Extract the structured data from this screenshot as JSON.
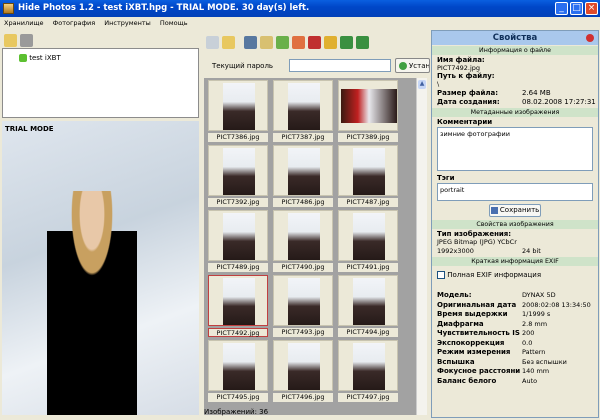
{
  "window": {
    "title": "Hide Photos 1.2 - test iXBT.hpg - TRIAL MODE. 30 day(s) left."
  },
  "menu": [
    "Хранилище",
    "Фотография",
    "Инструменты",
    "Помощь"
  ],
  "tree": {
    "item": "test iXBT"
  },
  "preview": {
    "overlay": "TRIAL MODE"
  },
  "password": {
    "label": "Текущий пароль",
    "value": "",
    "button": "Устан"
  },
  "thumbnails": [
    {
      "name": "PICT7386.jpg"
    },
    {
      "name": "PICT7387.jpg"
    },
    {
      "name": "PICT7389.jpg"
    },
    {
      "name": "PICT7392.jpg"
    },
    {
      "name": "PICT7486.jpg"
    },
    {
      "name": "PICT7487.jpg"
    },
    {
      "name": "PICT7489.jpg"
    },
    {
      "name": "PICT7490.jpg"
    },
    {
      "name": "PICT7491.jpg"
    },
    {
      "name": "PICT7492.jpg",
      "selected": true
    },
    {
      "name": "PICT7493.jpg"
    },
    {
      "name": "PICT7494.jpg"
    },
    {
      "name": "PICT7495.jpg"
    },
    {
      "name": "PICT7496.jpg"
    },
    {
      "name": "PICT7497.jpg"
    }
  ],
  "status": "Изображений: 36",
  "props": {
    "title": "Свойства",
    "file_section": "Информация о файле",
    "file_name_label": "Имя файла:",
    "file_name": "PICT7492.jpg",
    "path_label": "Путь к файлу:",
    "path": "\\",
    "size_label": "Размер файла:",
    "size": "2.64 MB",
    "date_label": "Дата создания:",
    "date": "08.02.2008 17:27:31",
    "meta_section": "Метаданные изображения",
    "comment_label": "Комментарии",
    "comment": "зимние фотографии",
    "tags_label": "Тэги",
    "tags": "portrait",
    "save": "Сохранить",
    "image_section": "Свойства изображения",
    "type_label": "Тип изображения:",
    "type": "JPEG Bitmap (JPG) YCbCr",
    "dims": "1992x3000",
    "bits": "24 bit",
    "exif_section": "Краткая информация EXIF",
    "full_exif": "Полная EXIF информация",
    "exif": [
      {
        "k": "Модель:",
        "v": "DYNAX 5D"
      },
      {
        "k": "Оригинальная дата",
        "v": "2008:02:08 13:34:50"
      },
      {
        "k": "Время выдержки",
        "v": "1/1999 s"
      },
      {
        "k": "Диафрагма",
        "v": "2.8 mm"
      },
      {
        "k": "Чувствительность IS",
        "v": "200"
      },
      {
        "k": "Экспокоррекция",
        "v": "0.0"
      },
      {
        "k": "Режим измерения",
        "v": "Pattern"
      },
      {
        "k": "Вспышка",
        "v": "Без вспышки"
      },
      {
        "k": "Фокусное расстояни",
        "v": "140 mm"
      },
      {
        "k": "Баланс белого",
        "v": "Auto"
      }
    ]
  }
}
